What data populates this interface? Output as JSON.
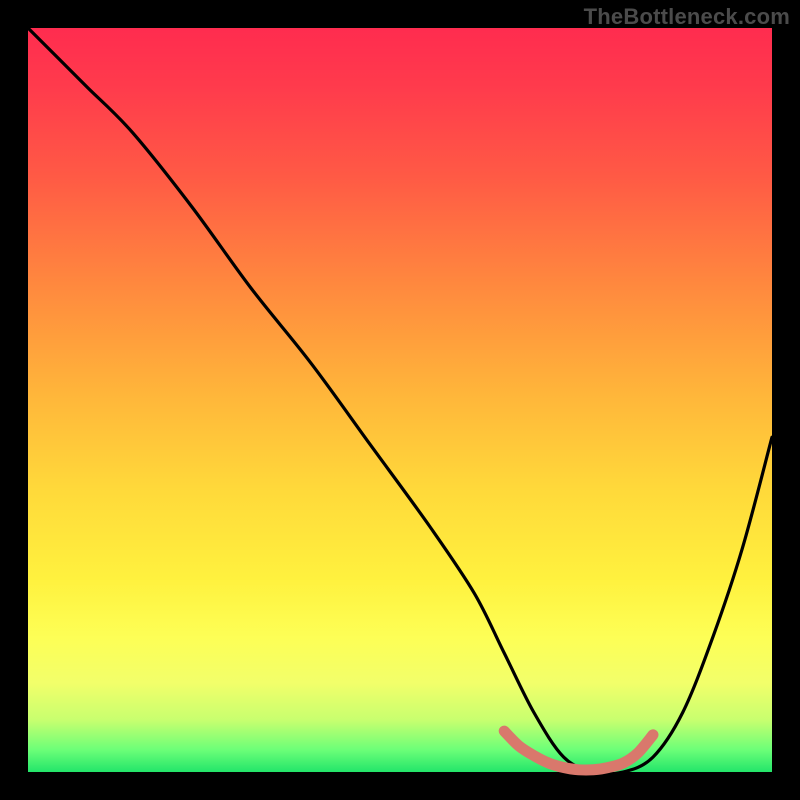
{
  "watermark": "TheBottleneck.com",
  "colors": {
    "page_bg": "#000000",
    "grad_top": "#ff2c4f",
    "grad_bottom": "#23e56a",
    "line": "#000000",
    "marker": "#d9786c"
  },
  "chart_data": {
    "type": "line",
    "title": "",
    "xlabel": "",
    "ylabel": "",
    "xlim": [
      0,
      100
    ],
    "ylim": [
      0,
      100
    ],
    "series": [
      {
        "name": "bottleneck-curve",
        "x": [
          0,
          4,
          8,
          14,
          22,
          30,
          38,
          46,
          54,
          60,
          64,
          68,
          72,
          76,
          80,
          84,
          88,
          92,
          96,
          100
        ],
        "y": [
          100,
          96,
          92,
          86,
          76,
          65,
          55,
          44,
          33,
          24,
          16,
          8,
          2,
          0,
          0,
          2,
          8,
          18,
          30,
          45
        ]
      }
    ],
    "highlight": {
      "name": "optimal-range",
      "x": [
        64,
        66,
        68,
        70,
        72,
        74,
        76,
        78,
        80,
        82,
        84
      ],
      "y": [
        5.5,
        3.5,
        2.2,
        1.2,
        0.6,
        0.3,
        0.3,
        0.6,
        1.2,
        2.6,
        5.0
      ]
    }
  }
}
